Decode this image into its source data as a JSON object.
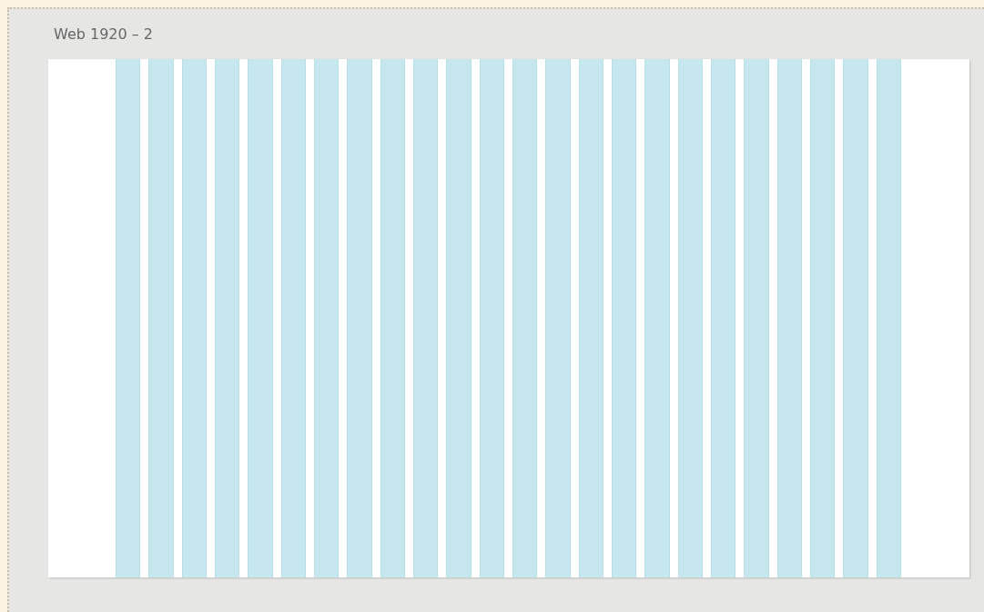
{
  "artboard": {
    "title": "Web 1920 – 2",
    "layout_grid": {
      "visible": true,
      "columns": [
        {
          "kind": "column"
        },
        {
          "kind": "column"
        },
        {
          "kind": "column"
        },
        {
          "kind": "column"
        },
        {
          "kind": "column"
        },
        {
          "kind": "column"
        },
        {
          "kind": "column"
        },
        {
          "kind": "column"
        },
        {
          "kind": "column"
        },
        {
          "kind": "column"
        },
        {
          "kind": "column"
        },
        {
          "kind": "column"
        },
        {
          "kind": "column"
        },
        {
          "kind": "column"
        },
        {
          "kind": "column"
        },
        {
          "kind": "column"
        },
        {
          "kind": "column"
        },
        {
          "kind": "column"
        },
        {
          "kind": "column"
        },
        {
          "kind": "column"
        },
        {
          "kind": "column"
        },
        {
          "kind": "column"
        },
        {
          "kind": "column"
        },
        {
          "kind": "column"
        }
      ]
    }
  }
}
